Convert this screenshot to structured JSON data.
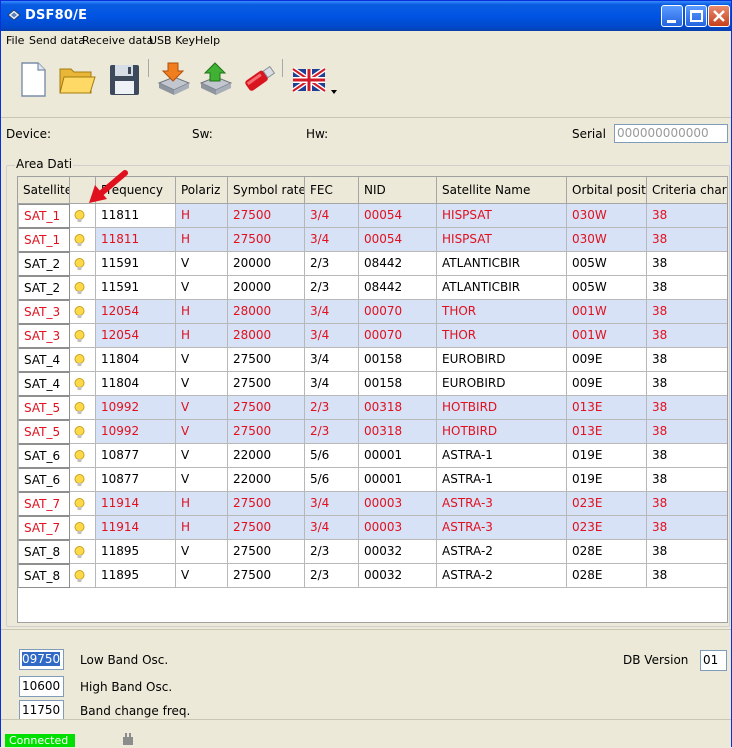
{
  "window": {
    "title": "DSF80/E"
  },
  "menu": [
    "File",
    "Send data",
    "Receive data",
    "USB Key",
    "Help"
  ],
  "toolbar": {
    "buttons": [
      "new-file-icon",
      "open-folder-icon",
      "save-disk-icon",
      "send-data-icon",
      "receive-data-icon",
      "usb-key-icon",
      "uk-flag-language-icon"
    ]
  },
  "device_info": {
    "device_label": "Device:",
    "sw_label": "Sw:",
    "hw_label": "Hw:",
    "serial_label": "Serial",
    "serial_value": "000000000000"
  },
  "area": {
    "label": "Area Dati",
    "columns": [
      "Satellite",
      "",
      "Frequency",
      "Polariz",
      "Symbol rate",
      "FEC",
      "NID",
      "Satellite Name",
      "Orbital posit",
      "Criteria char"
    ],
    "rows": [
      {
        "sat": "SAT_1",
        "freq": "11811",
        "pol": "H",
        "sr": "27500",
        "fec": "3/4",
        "nid": "00054",
        "name": "HISPSAT",
        "orb": "030W",
        "crit": "38",
        "red": true,
        "editing": true
      },
      {
        "sat": "SAT_1",
        "freq": "11811",
        "pol": "H",
        "sr": "27500",
        "fec": "3/4",
        "nid": "00054",
        "name": "HISPSAT",
        "orb": "030W",
        "crit": "38",
        "red": true
      },
      {
        "sat": "SAT_2",
        "freq": "11591",
        "pol": "V",
        "sr": "20000",
        "fec": "2/3",
        "nid": "08442",
        "name": "ATLANTICBIR",
        "orb": "005W",
        "crit": "38",
        "red": false
      },
      {
        "sat": "SAT_2",
        "freq": "11591",
        "pol": "V",
        "sr": "20000",
        "fec": "2/3",
        "nid": "08442",
        "name": "ATLANTICBIR",
        "orb": "005W",
        "crit": "38",
        "red": false
      },
      {
        "sat": "SAT_3",
        "freq": "12054",
        "pol": "H",
        "sr": "28000",
        "fec": "3/4",
        "nid": "00070",
        "name": "THOR",
        "orb": "001W",
        "crit": "38",
        "red": true
      },
      {
        "sat": "SAT_3",
        "freq": "12054",
        "pol": "H",
        "sr": "28000",
        "fec": "3/4",
        "nid": "00070",
        "name": "THOR",
        "orb": "001W",
        "crit": "38",
        "red": true
      },
      {
        "sat": "SAT_4",
        "freq": "11804",
        "pol": "V",
        "sr": "27500",
        "fec": "3/4",
        "nid": "00158",
        "name": "EUROBIRD",
        "orb": "009E",
        "crit": "38",
        "red": false
      },
      {
        "sat": "SAT_4",
        "freq": "11804",
        "pol": "V",
        "sr": "27500",
        "fec": "3/4",
        "nid": "00158",
        "name": "EUROBIRD",
        "orb": "009E",
        "crit": "38",
        "red": false
      },
      {
        "sat": "SAT_5",
        "freq": "10992",
        "pol": "V",
        "sr": "27500",
        "fec": "2/3",
        "nid": "00318",
        "name": "HOTBIRD",
        "orb": "013E",
        "crit": "38",
        "red": true
      },
      {
        "sat": "SAT_5",
        "freq": "10992",
        "pol": "V",
        "sr": "27500",
        "fec": "2/3",
        "nid": "00318",
        "name": "HOTBIRD",
        "orb": "013E",
        "crit": "38",
        "red": true
      },
      {
        "sat": "SAT_6",
        "freq": "10877",
        "pol": "V",
        "sr": "22000",
        "fec": "5/6",
        "nid": "00001",
        "name": "ASTRA-1",
        "orb": "019E",
        "crit": "38",
        "red": false
      },
      {
        "sat": "SAT_6",
        "freq": "10877",
        "pol": "V",
        "sr": "22000",
        "fec": "5/6",
        "nid": "00001",
        "name": "ASTRA-1",
        "orb": "019E",
        "crit": "38",
        "red": false
      },
      {
        "sat": "SAT_7",
        "freq": "11914",
        "pol": "H",
        "sr": "27500",
        "fec": "3/4",
        "nid": "00003",
        "name": "ASTRA-3",
        "orb": "023E",
        "crit": "38",
        "red": true
      },
      {
        "sat": "SAT_7",
        "freq": "11914",
        "pol": "H",
        "sr": "27500",
        "fec": "3/4",
        "nid": "00003",
        "name": "ASTRA-3",
        "orb": "023E",
        "crit": "38",
        "red": true
      },
      {
        "sat": "SAT_8",
        "freq": "11895",
        "pol": "V",
        "sr": "27500",
        "fec": "2/3",
        "nid": "00032",
        "name": "ASTRA-2",
        "orb": "028E",
        "crit": "38",
        "red": false
      },
      {
        "sat": "SAT_8",
        "freq": "11895",
        "pol": "V",
        "sr": "27500",
        "fec": "2/3",
        "nid": "00032",
        "name": "ASTRA-2",
        "orb": "028E",
        "crit": "38",
        "red": false
      }
    ]
  },
  "oscillators": {
    "low_value": "09750",
    "low_label": "Low Band Osc.",
    "high_value": "10600",
    "high_label": "High Band Osc.",
    "change_value": "11750",
    "change_label": "Band change freq."
  },
  "db_version": {
    "label": "DB Version",
    "value": "01"
  },
  "status": {
    "connection": "Connected"
  },
  "colors": {
    "red_text": "#e0101e",
    "row_highlight": "#d8e2f6",
    "title_blue": "#0054e3",
    "connected_green": "#00e000"
  }
}
